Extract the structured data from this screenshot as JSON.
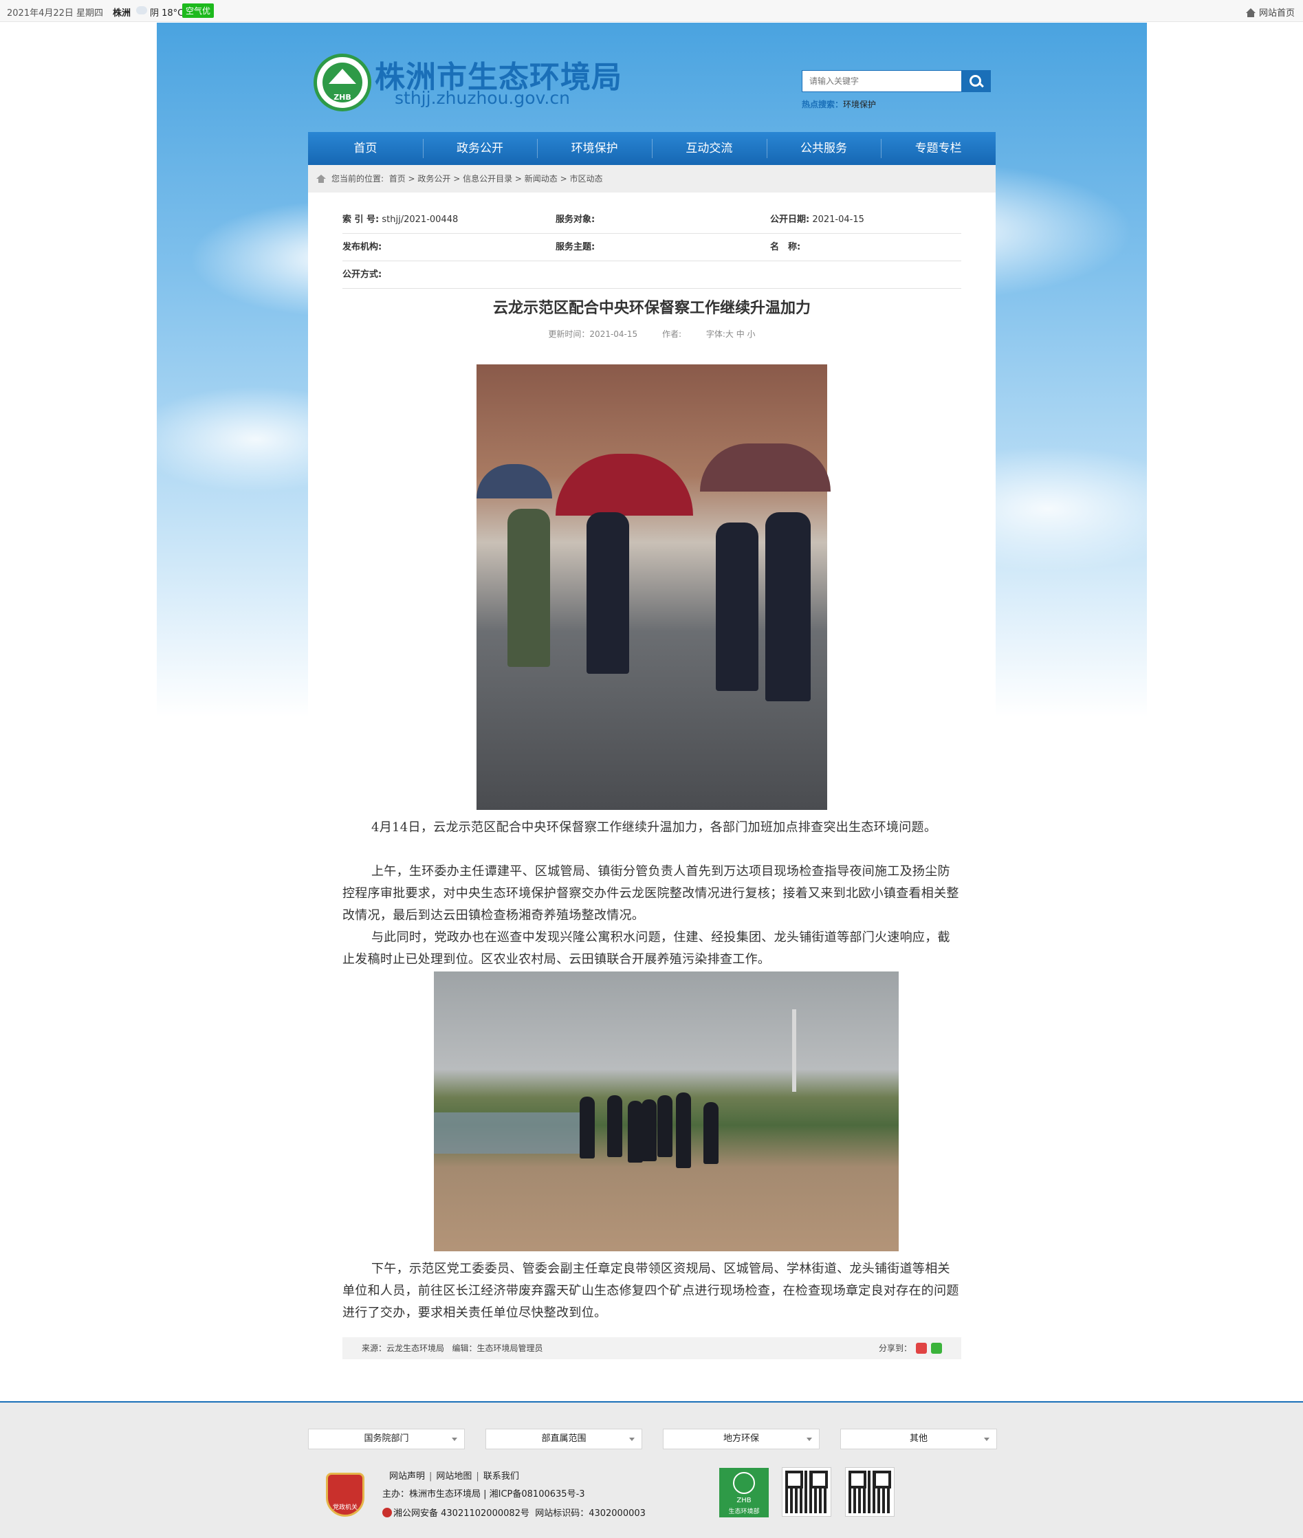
{
  "topbar": {
    "date": "2021年4月22日 星期四",
    "city": "株洲",
    "weather": "阴 18°C",
    "air_quality": "空气优",
    "home_link": "网站首页"
  },
  "header": {
    "site_title": "株洲市生态环境局",
    "site_url": "sthjj.zhuzhou.gov.cn",
    "search_placeholder": "请输入关键字",
    "hot_label": "热点搜索：",
    "hot_term": "环境保护"
  },
  "nav": [
    "首页",
    "政务公开",
    "环境保护",
    "互动交流",
    "公共服务",
    "专题专栏"
  ],
  "breadcrumb": {
    "label": "您当前的位置:",
    "items": [
      "首页",
      "政务公开",
      "信息公开目录",
      "新闻动态",
      "市区动态"
    ],
    "separator": " > "
  },
  "meta": {
    "index_label": "索 引 号:",
    "index_value": "sthjj/2021-00448",
    "service_obj_label": "服务对象:",
    "public_date_label": "公开日期:",
    "public_date_value": "2021-04-15",
    "publisher_label": "发布机构:",
    "service_topic_label": "服务主题:",
    "name_label": "名　称:",
    "public_method_label": "公开方式:"
  },
  "article": {
    "title": "云龙示范区配合中央环保督察工作继续升温加力",
    "updated": "更新时间：2021-04-15",
    "author": "作者:",
    "font_size": "字体:大 中 小",
    "paragraphs": [
      "4月14日，云龙示范区配合中央环保督察工作继续升温加力，各部门加班加点排查突出生态环境问题。",
      "上午，生环委办主任谭建平、区城管局、镇街分管负责人首先到万达项目现场检查指导夜间施工及扬尘防控程序审批要求，对中央生态环境保护督察交办件云龙医院整改情况进行复核；接着又来到北欧小镇查看相关整改情况，最后到达云田镇检查杨湘奇养殖场整改情况。",
      "与此同时，党政办也在巡查中发现兴隆公寓积水问题，住建、经投集团、龙头铺街道等部门火速响应，截止发稿时止已处理到位。区农业农村局、云田镇联合开展养殖污染排查工作。",
      "下午，示范区党工委委员、管委会副主任章定良带领区资规局、区城管局、学林街道、龙头铺街道等相关单位和人员，前往区长江经济带废弃露天矿山生态修复四个矿点进行现场检查，在检查现场章定良对存在的问题进行了交办，要求相关责任单位尽快整改到位。"
    ],
    "source": "来源：云龙生态环境局",
    "editor": "编辑：生态环境局管理员",
    "share": "分享到："
  },
  "footer": {
    "link_boxes": [
      "国务院部门",
      "部直属范围",
      "地方环保",
      "其他"
    ],
    "links": [
      "网站声明",
      "网站地图",
      "联系我们"
    ],
    "sponsor": "主办：株洲市生态环境局 | 湘ICP备08100635号-3",
    "police": "湘公网安备 43021102000082号",
    "site_code": "网站标识码：4302000003",
    "badge_text": "党政机关",
    "green_logo_t1": "ZHB",
    "green_logo_t2": "生态环境部"
  },
  "colors": {
    "brand_blue": "#1a6fb8",
    "brand_green": "#2e9a47",
    "air_quality_green": "#1db91d"
  }
}
